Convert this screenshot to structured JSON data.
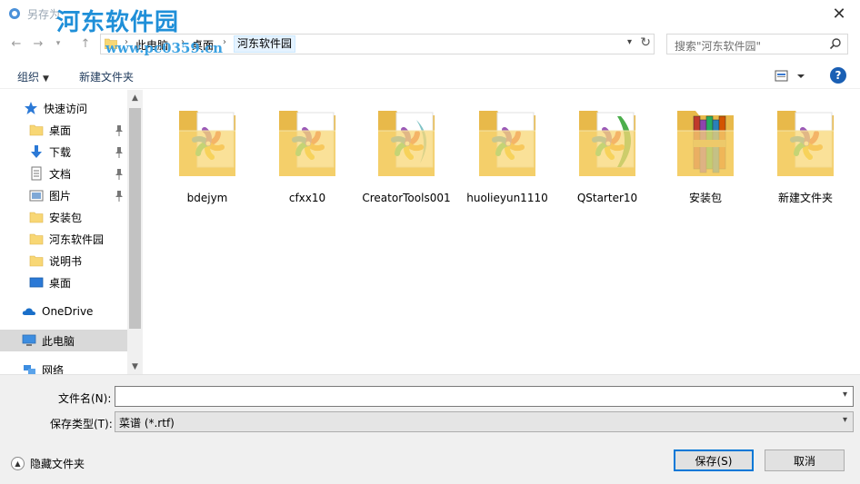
{
  "window": {
    "title": "另存为",
    "watermark": "河东软件园",
    "watermark_url": "www.pc0359.cn"
  },
  "address": {
    "crumbs": [
      "此电脑",
      "桌面",
      "河东软件园"
    ]
  },
  "search": {
    "placeholder": "搜索\"河东软件园\""
  },
  "toolbar": {
    "organize": "组织",
    "new_folder": "新建文件夹"
  },
  "nav": {
    "quick_access": "快速访问",
    "items": [
      {
        "label": "桌面",
        "icon": "folder-icon",
        "pinned": true
      },
      {
        "label": "下载",
        "icon": "download-arrow-icon",
        "pinned": true
      },
      {
        "label": "文档",
        "icon": "document-icon",
        "pinned": true
      },
      {
        "label": "图片",
        "icon": "pictures-icon",
        "pinned": true
      },
      {
        "label": "安装包",
        "icon": "folder-icon",
        "pinned": false
      },
      {
        "label": "河东软件园",
        "icon": "folder-icon",
        "pinned": false
      },
      {
        "label": "说明书",
        "icon": "folder-icon",
        "pinned": false
      },
      {
        "label": "桌面",
        "icon": "desktop-icon",
        "pinned": false
      }
    ],
    "onedrive": "OneDrive",
    "this_pc": "此电脑",
    "network": "网络"
  },
  "files": [
    {
      "name": "bdejym",
      "overlay": "pinwheel"
    },
    {
      "name": "cfxx10",
      "overlay": "pinwheel"
    },
    {
      "name": "CreatorTools001",
      "overlay": "pinwheel-creator"
    },
    {
      "name": "huolieyun1110",
      "overlay": "pinwheel"
    },
    {
      "name": "QStarter10",
      "overlay": "pinwheel-green"
    },
    {
      "name": "安装包",
      "overlay": "archive"
    },
    {
      "name": "新建文件夹",
      "overlay": "pinwheel"
    }
  ],
  "form": {
    "filename_label": "文件名(N):",
    "filename_value": "",
    "filetype_label": "保存类型(T):",
    "filetype_value": "菜谱 (*.rtf)",
    "hide_folders": "隐藏文件夹",
    "save": "保存(S)",
    "cancel": "取消"
  },
  "colors": {
    "accent": "#0078d7",
    "watermark": "#1f8fd8",
    "folder": "#f8d775",
    "selected": "#d9d9d9"
  }
}
